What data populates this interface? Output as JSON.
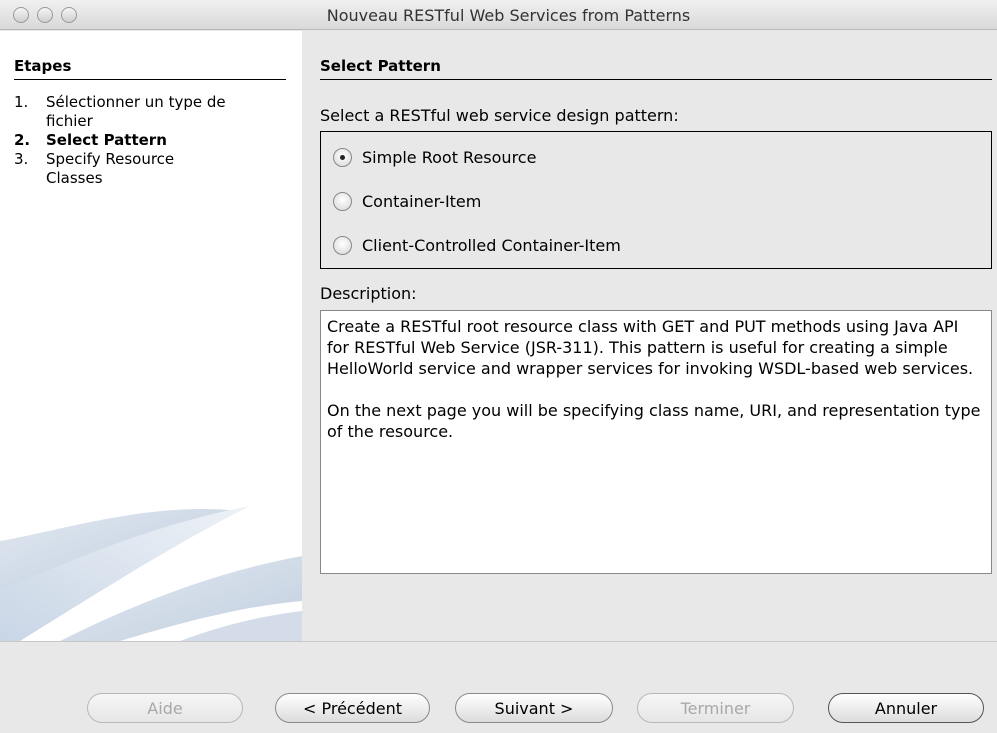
{
  "window": {
    "title": "Nouveau RESTful Web Services from Patterns"
  },
  "steps": {
    "header": "Etapes",
    "items": [
      {
        "num": "1.",
        "label": "Sélectionner un type de fichier",
        "current": false
      },
      {
        "num": "2.",
        "label": "Select Pattern",
        "current": true
      },
      {
        "num": "3.",
        "label": "Specify Resource Classes",
        "current": false
      }
    ]
  },
  "panel": {
    "header": "Select Pattern",
    "prompt": "Select a RESTful web service design pattern:",
    "options": [
      {
        "label": "Simple Root Resource",
        "checked": true
      },
      {
        "label": "Container-Item",
        "checked": false
      },
      {
        "label": "Client-Controlled Container-Item",
        "checked": false
      }
    ],
    "description_label": "Description:",
    "description_paragraphs": [
      "Create a RESTful root resource class with GET and PUT methods using Java API for RESTful Web Service (JSR-311). This pattern is useful for creating a simple HelloWorld service and wrapper services for invoking WSDL-based web services.",
      "On the next page you will be specifying class name, URI, and representation type of the resource."
    ]
  },
  "buttons": {
    "help": "Aide",
    "previous": "< Précédent",
    "next": "Suivant >",
    "finish": "Terminer",
    "cancel": "Annuler"
  }
}
